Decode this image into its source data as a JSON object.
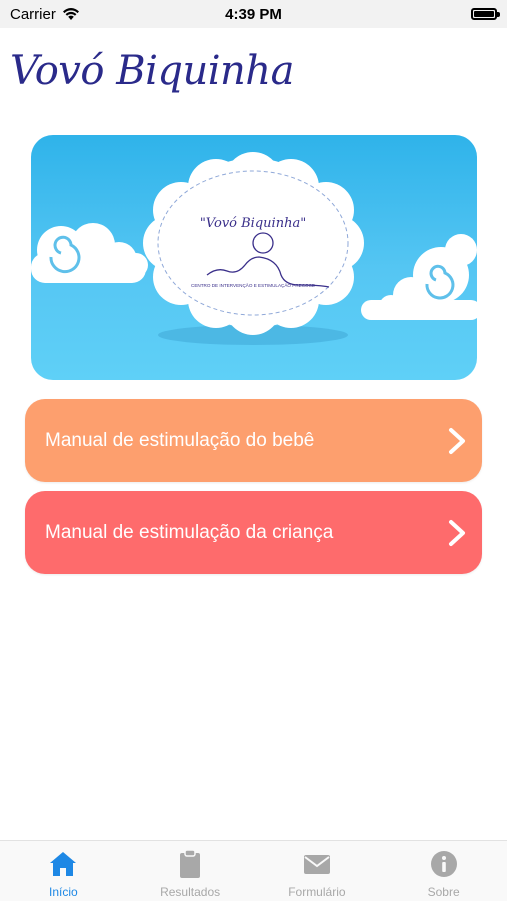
{
  "status_bar": {
    "carrier": "Carrier",
    "time": "4:39 PM"
  },
  "header": {
    "title": "Vovó Biquinha"
  },
  "banner": {
    "logo_title": "\"Vovó Biquinha\"",
    "logo_subtitle": "CENTRO DE INTERVENÇÃO E ESTIMULAÇÃO PRECOCE"
  },
  "menu": {
    "items": [
      {
        "label": "Manual de estimulação do bebê",
        "color": "#fd9f6e"
      },
      {
        "label": "Manual de estimulação da criança",
        "color": "#fe6b6c"
      }
    ]
  },
  "tab_bar": {
    "tabs": [
      {
        "label": "Início",
        "icon": "home-icon",
        "active": true
      },
      {
        "label": "Resultados",
        "icon": "clipboard-icon",
        "active": false
      },
      {
        "label": "Formulário",
        "icon": "mail-icon",
        "active": false
      },
      {
        "label": "Sobre",
        "icon": "info-icon",
        "active": false
      }
    ],
    "active_color": "#1e88e5",
    "inactive_color": "#a8a8a8"
  }
}
